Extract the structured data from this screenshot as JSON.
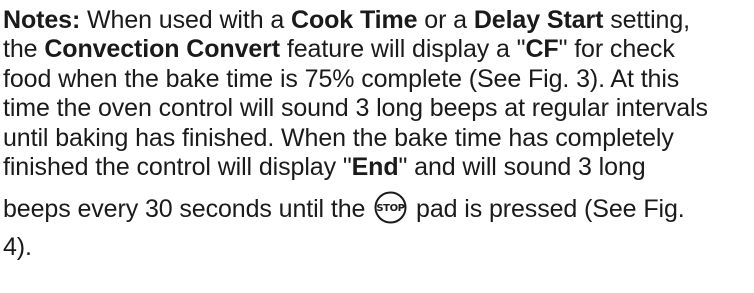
{
  "notes": {
    "label": "Notes:",
    "line1_a": " When used with a ",
    "line1_b": "Cook Time",
    "line1_c": " or a ",
    "line1_d": "Delay Start",
    "line1_e": " setting,",
    "line2_a": "the ",
    "line2_b": "Convection Convert",
    "line2_c": " feature will display a \"",
    "line2_d": "CF",
    "line2_e": "\" for check",
    "line3": "food when the bake time is 75% complete (See Fig. 3). At this",
    "line4": "time the oven control will sound 3 long beeps at regular intervals",
    "line5": "until baking has finished. When the bake time has completely",
    "line6_a": "finished the control will display \"",
    "line6_b": "End",
    "line6_c": "\" and will sound 3 long",
    "line7_a": "beeps every 30 seconds until the ",
    "stop_icon_text": "STOP",
    "line7_b": " pad is pressed (See Fig.",
    "line8": "4)."
  }
}
